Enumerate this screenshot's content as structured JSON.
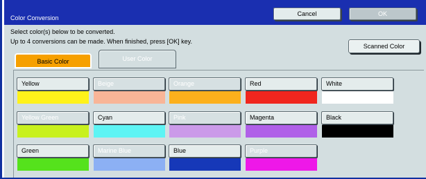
{
  "window": {
    "title": "Color Conversion"
  },
  "header_buttons": {
    "cancel": "Cancel",
    "ok": "OK"
  },
  "instructions": [
    "Select color(s) below to be converted.",
    "Up to 4 conversions can be made. When finished, press [OK] key."
  ],
  "scanned_button": "Scanned Color",
  "tabs": [
    {
      "label": "Basic Color",
      "active": true
    },
    {
      "label": "User Color",
      "active": false
    }
  ],
  "colors": [
    {
      "label": "Yellow",
      "enabled": true,
      "swatch": "#fff21a"
    },
    {
      "label": "Beige",
      "enabled": false,
      "swatch": "#f8b597"
    },
    {
      "label": "Orange",
      "enabled": false,
      "swatch": "#fcb01c"
    },
    {
      "label": "Red",
      "enabled": true,
      "swatch": "#f0261e"
    },
    {
      "label": "White",
      "enabled": true,
      "swatch": "#ffffff"
    },
    {
      "label": "Yellow Green",
      "enabled": false,
      "swatch": "#c8f11e"
    },
    {
      "label": "Cyan",
      "enabled": true,
      "swatch": "#5ef4f4"
    },
    {
      "label": "Pink",
      "enabled": false,
      "swatch": "#cb9ae9"
    },
    {
      "label": "Magenta",
      "enabled": true,
      "swatch": "#b060e8"
    },
    {
      "label": "Black",
      "enabled": true,
      "swatch": "#000000"
    },
    {
      "label": "Green",
      "enabled": true,
      "swatch": "#55e21c"
    },
    {
      "label": "Marine Blue",
      "enabled": false,
      "swatch": "#8cb0f4"
    },
    {
      "label": "Blue",
      "enabled": true,
      "swatch": "#1638b8"
    },
    {
      "label": "Purple",
      "enabled": false,
      "swatch": "#ee18e8"
    }
  ]
}
